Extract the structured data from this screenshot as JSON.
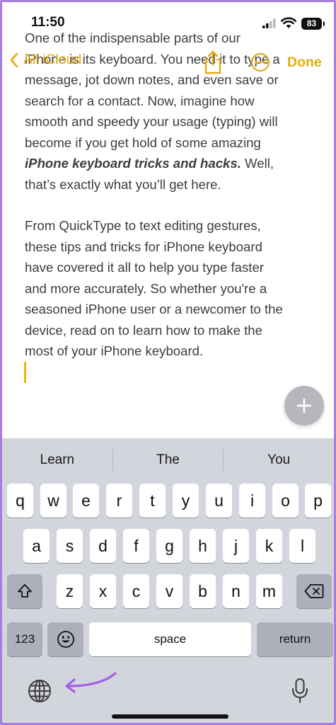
{
  "status_bar": {
    "time": "11:50",
    "battery": "83"
  },
  "nav": {
    "back_label": "All iCloud",
    "done_label": "Done"
  },
  "note": {
    "line1": "One of the indispensable parts of our",
    "line2": "iPhone is its keyboard. You need it to type a",
    "line3": "message, jot down notes, and even save or",
    "line4": "search for a contact. Now, imagine how",
    "line5": "smooth and speedy your usage (typing) will",
    "line6": "become if you get hold of some amazing",
    "line7_bold": "iPhone keyboard tricks and hacks.",
    "line7_rest": " Well,",
    "line8": "that’s exactly what you’ll get here.",
    "para2": [
      "From QuickType to text editing gestures,",
      "these tips and tricks for iPhone keyboard",
      "have covered it all to help you type faster",
      "and more accurately. So whether you're a",
      "seasoned iPhone user or a newcomer to the",
      "device, read on to learn how to make the",
      "most of your iPhone keyboard."
    ]
  },
  "keyboard": {
    "suggestions": [
      "Learn",
      "The",
      "You"
    ],
    "row1": [
      "q",
      "w",
      "e",
      "r",
      "t",
      "y",
      "u",
      "i",
      "o",
      "p"
    ],
    "row2": [
      "a",
      "s",
      "d",
      "f",
      "g",
      "h",
      "j",
      "k",
      "l"
    ],
    "row3": [
      "z",
      "x",
      "c",
      "v",
      "b",
      "n",
      "m"
    ],
    "numbers_label": "123",
    "space_label": "space",
    "return_label": "return"
  },
  "colors": {
    "accent": "#e5ab0f",
    "annotation_arrow": "#a45ee5",
    "keyboard_bg": "#d3d5dc"
  }
}
